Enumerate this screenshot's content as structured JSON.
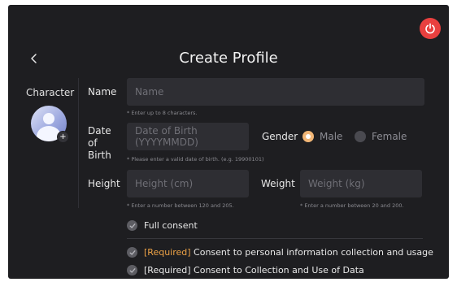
{
  "header": {
    "title": "Create Profile"
  },
  "character": {
    "label": "Character",
    "add_symbol": "+"
  },
  "form": {
    "name": {
      "label": "Name",
      "placeholder": "Name",
      "hint": "* Enter up to 8 characters."
    },
    "dob": {
      "label": "Date of Birth",
      "placeholder": "Date of Birth (YYYYMMDD)",
      "hint": "* Please enter a valid date of birth. (e.g. 19900101)"
    },
    "gender": {
      "label": "Gender",
      "options": [
        {
          "label": "Male",
          "selected": true
        },
        {
          "label": "Female",
          "selected": false
        }
      ]
    },
    "height": {
      "label": "Height",
      "placeholder": "Height (cm)",
      "hint": "* Enter a number between 120 and 205."
    },
    "weight": {
      "label": "Weight",
      "placeholder": "Weight (kg)",
      "hint": "* Enter a number between 20 and 200."
    }
  },
  "consents": {
    "full": {
      "text": "Full consent"
    },
    "items": [
      {
        "tag": "[Required]",
        "text": " Consent to personal information collection and usage"
      },
      {
        "tag": "",
        "text": "[Required] Consent to Collection and Use of Data"
      }
    ]
  },
  "colors": {
    "accent": "#f1b676",
    "power": "#e9403f",
    "required": "#eda246",
    "background": "#1e1e21",
    "field": "#2e2e33"
  },
  "icons": {
    "power": "power-icon",
    "back": "chevron-left-icon",
    "check": "check-icon",
    "add": "plus-icon"
  }
}
